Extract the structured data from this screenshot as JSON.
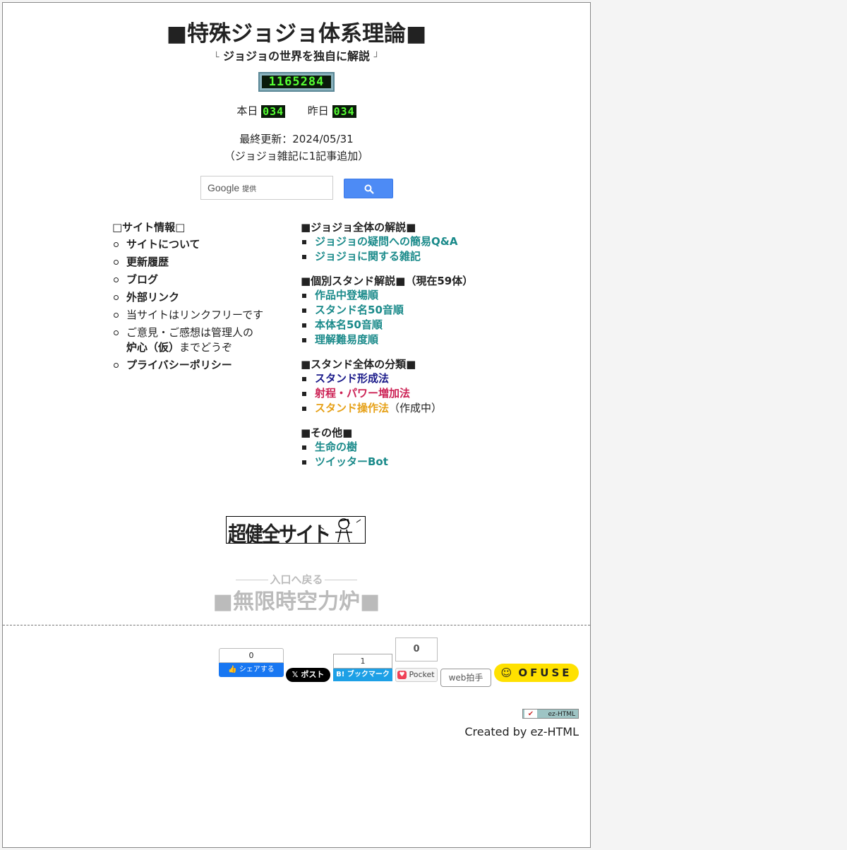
{
  "header": {
    "title": "■特殊ジョジョ体系理論■",
    "subtitle_corner_left": "└",
    "subtitle": "ジョジョの世界を独自に解説",
    "subtitle_corner_right": "┘"
  },
  "counter": {
    "total": "1165284",
    "today_label": "本日",
    "today_value": "034",
    "yesterday_label": "昨日",
    "yesterday_value": "034"
  },
  "update": {
    "line1": "最終更新：2024/05/31",
    "line2": "（ジョジョ雑記に1記事追加）"
  },
  "search": {
    "brand": "Google",
    "provided": "提供"
  },
  "site_info": {
    "heading": "□サイト情報□",
    "items": [
      {
        "label": "サイトについて"
      },
      {
        "label": "更新履歴"
      },
      {
        "label": "ブログ"
      },
      {
        "label": "外部リンク"
      },
      {
        "label": "当サイトはリンクフリーです"
      },
      {
        "label_prefix": "ご意見・ご感想は管理人の",
        "label_bold": "炉心（仮）",
        "label_suffix": "までどうぞ"
      },
      {
        "label": "プライバシーポリシー"
      }
    ]
  },
  "overall": {
    "heading": "■ジョジョ全体の解説■",
    "items": [
      "ジョジョの疑問への簡易Q&A",
      "ジョジョに関する雑記"
    ]
  },
  "stands": {
    "heading": "■個別スタンド解説■（現在59体）",
    "items": [
      "作品中登場順",
      "スタンド名50音順",
      "本体名50音順",
      "理解難易度順"
    ]
  },
  "classification": {
    "heading": "■スタンド全体の分類■",
    "items": [
      "スタンド形成法",
      "射程・パワー増加法",
      "スタンド操作法"
    ],
    "note": "（作成中）"
  },
  "other": {
    "heading": "■その他■",
    "items": [
      "生命の樹",
      "ツイッターBot"
    ]
  },
  "banner": {
    "text": "超健全サイト"
  },
  "back": {
    "small": "入口へ戻る",
    "big": "■無限時空力炉■"
  },
  "social": {
    "fb_count": "0",
    "fb_label": "シェアする",
    "x_label": "𝕏 ポスト",
    "hatena_count": "1",
    "hatena_label": "B! ブックマーク",
    "pocket_count": "0",
    "pocket_label": "Pocket",
    "webclap_label": "web拍手",
    "ofuse_label": "OFUSE"
  },
  "footer": {
    "badge": "ez-HTML",
    "created": "Created by ez-HTML"
  }
}
